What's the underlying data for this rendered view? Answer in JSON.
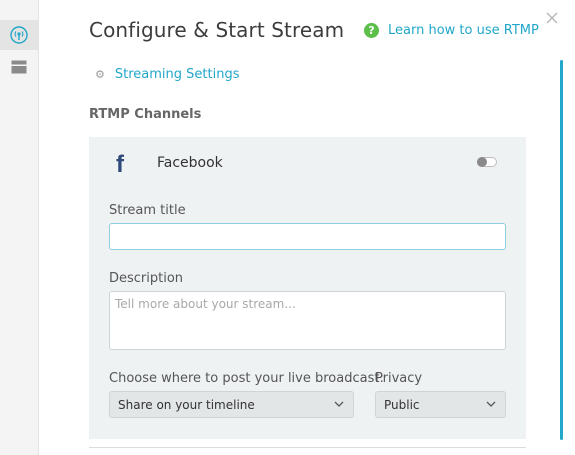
{
  "header": {
    "title": "Configure & Start Stream",
    "help_link": "Learn how to use RTMP",
    "help_icon": "?"
  },
  "settings_link": "Streaming Settings",
  "section_title": "RTMP Channels",
  "channel": {
    "icon": "f",
    "name": "Facebook",
    "enabled": false,
    "stream_title_label": "Stream title",
    "stream_title_value": "",
    "description_label": "Description",
    "description_placeholder": "Tell more about your stream...",
    "post_where_label": "Choose where to post your live broadcast:",
    "post_where_value": "Share on your timeline",
    "privacy_label": "Privacy",
    "privacy_value": "Public"
  },
  "colors": {
    "accent": "#22a7c9",
    "help_icon": "#5bbf4a",
    "facebook": "#2f4a7a"
  },
  "rail": {
    "icons": [
      "broadcast-icon",
      "layout-icon"
    ]
  }
}
